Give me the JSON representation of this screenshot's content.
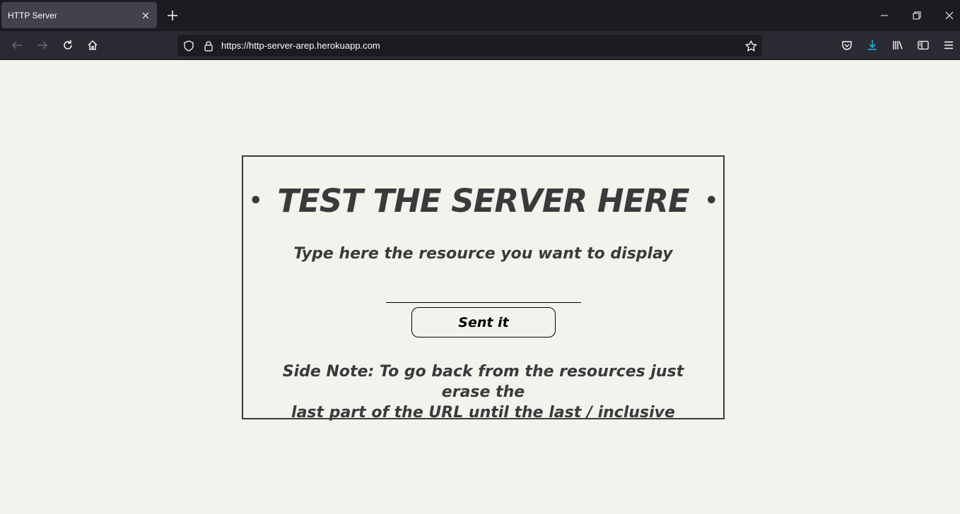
{
  "browser": {
    "tab_title": "HTTP Server",
    "url": "https://http-server-arep.herokuapp.com",
    "colors": {
      "tabbar": "#1c1b22",
      "navbar": "#2b2a33",
      "download_accent": "#54ffbd"
    }
  },
  "page": {
    "heading_dot_left": "•",
    "heading": "TEST THE SERVER HERE",
    "heading_dot_right": "•",
    "subtitle": "Type here the resource you want to display",
    "input_value": "",
    "button_label": "Sent it",
    "note_line1": "Side Note: To go back from the resources just erase the",
    "note_line2": "last part of the URL until the last / inclusive",
    "colors": {
      "background": "#f2f3ec",
      "text": "#3a3a3c"
    }
  }
}
